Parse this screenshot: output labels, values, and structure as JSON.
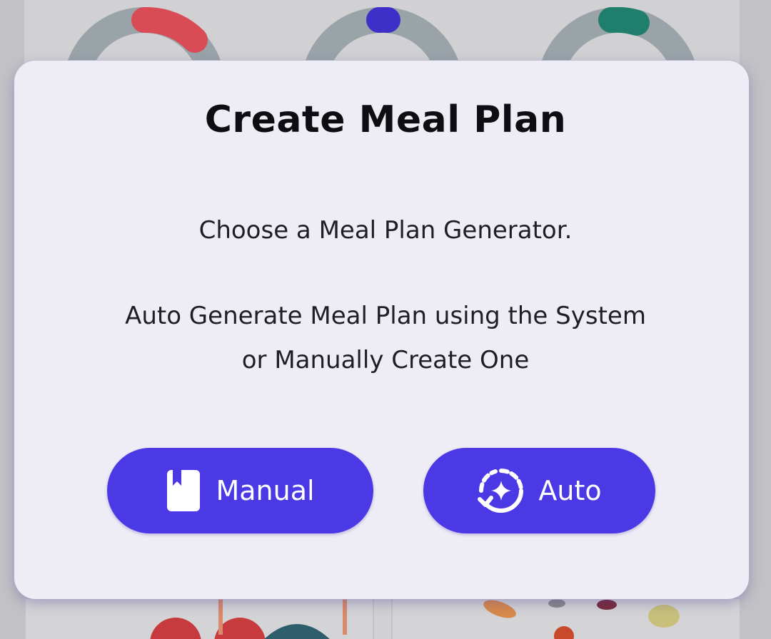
{
  "dialog": {
    "title": "Create Meal Plan",
    "line1": "Choose a Meal Plan Generator.",
    "line2": "Auto Generate Meal Plan using the System",
    "line3": "or Manually Create One",
    "buttons": {
      "manual": {
        "label": "Manual",
        "icon": "book-icon"
      },
      "auto": {
        "label": "Auto",
        "icon": "auto-sparkle-icon"
      }
    }
  },
  "colors": {
    "accent": "#4c39e6",
    "dialog_bg": "#eeedf6",
    "ring_track": "#9aa3a8",
    "ring_red": "#d94b55",
    "ring_blue": "#3e2fc9",
    "ring_green": "#1f7e6c"
  }
}
